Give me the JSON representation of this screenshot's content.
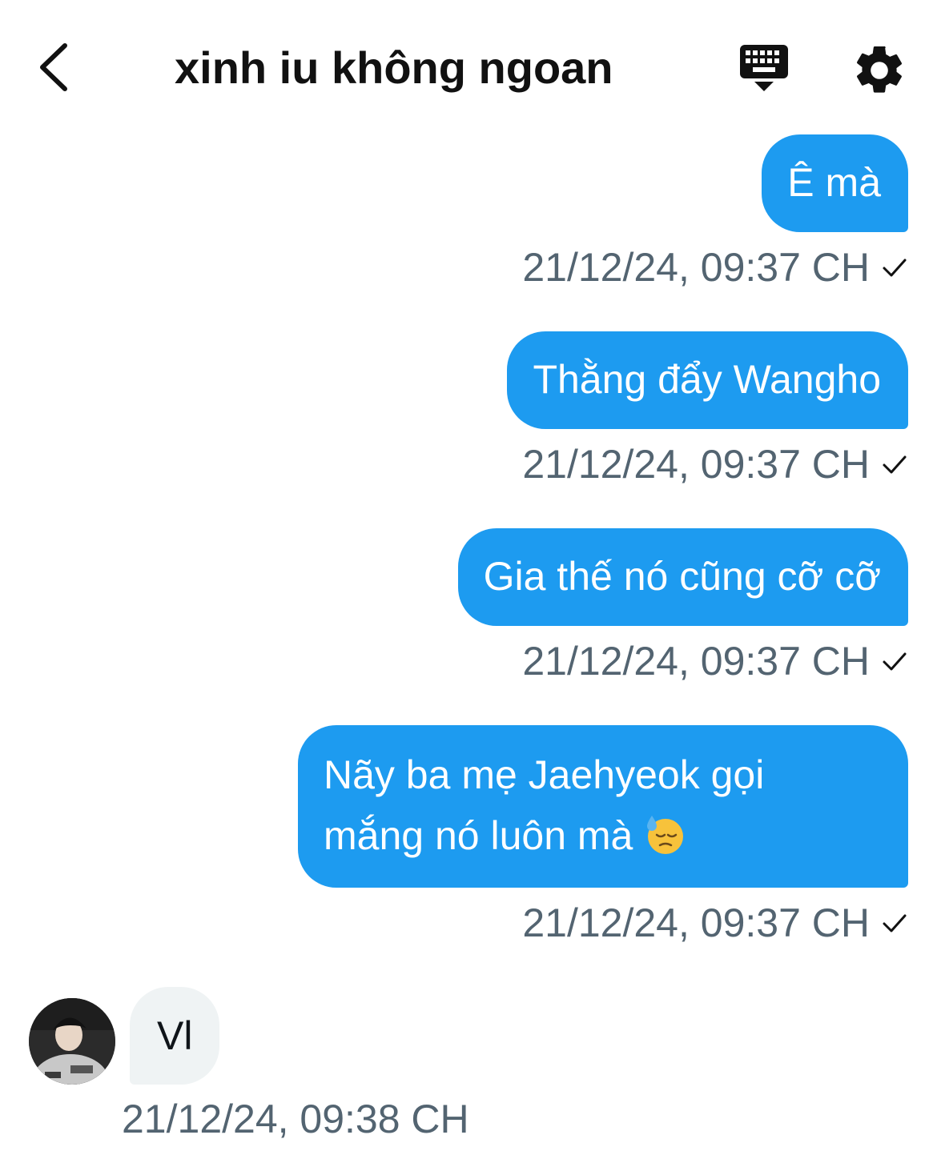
{
  "header": {
    "title": "xinh iu không ngoan",
    "back_icon": "chevron-left-icon",
    "keyboard_icon": "keyboard-icon",
    "settings_icon": "gear-icon"
  },
  "messages_out": [
    {
      "text": "Ê mà",
      "time": "21/12/24, 09:37 CH",
      "status": "sent-check-icon"
    },
    {
      "text": "Thằng đẩy Wangho",
      "time": "21/12/24, 09:37 CH",
      "status": "sent-check-icon"
    },
    {
      "text": "Gia thế nó cũng cỡ cỡ",
      "time": "21/12/24, 09:37 CH",
      "status": "sent-check-icon"
    },
    {
      "line1": "Nãy ba mẹ Jaehyeok gọi",
      "line2": "mắng nó luôn mà",
      "emoji": "downcast-sweat-face-emoji",
      "time": "21/12/24, 09:37 CH",
      "status": "sent-check-icon"
    }
  ],
  "message_in": {
    "text": "Vl",
    "time": "21/12/24, 09:38 CH",
    "avatar": "contact-avatar"
  },
  "colors": {
    "outgoing_bubble": "#1d9bf0",
    "incoming_bubble": "#eff3f4",
    "timestamp": "#536471"
  }
}
